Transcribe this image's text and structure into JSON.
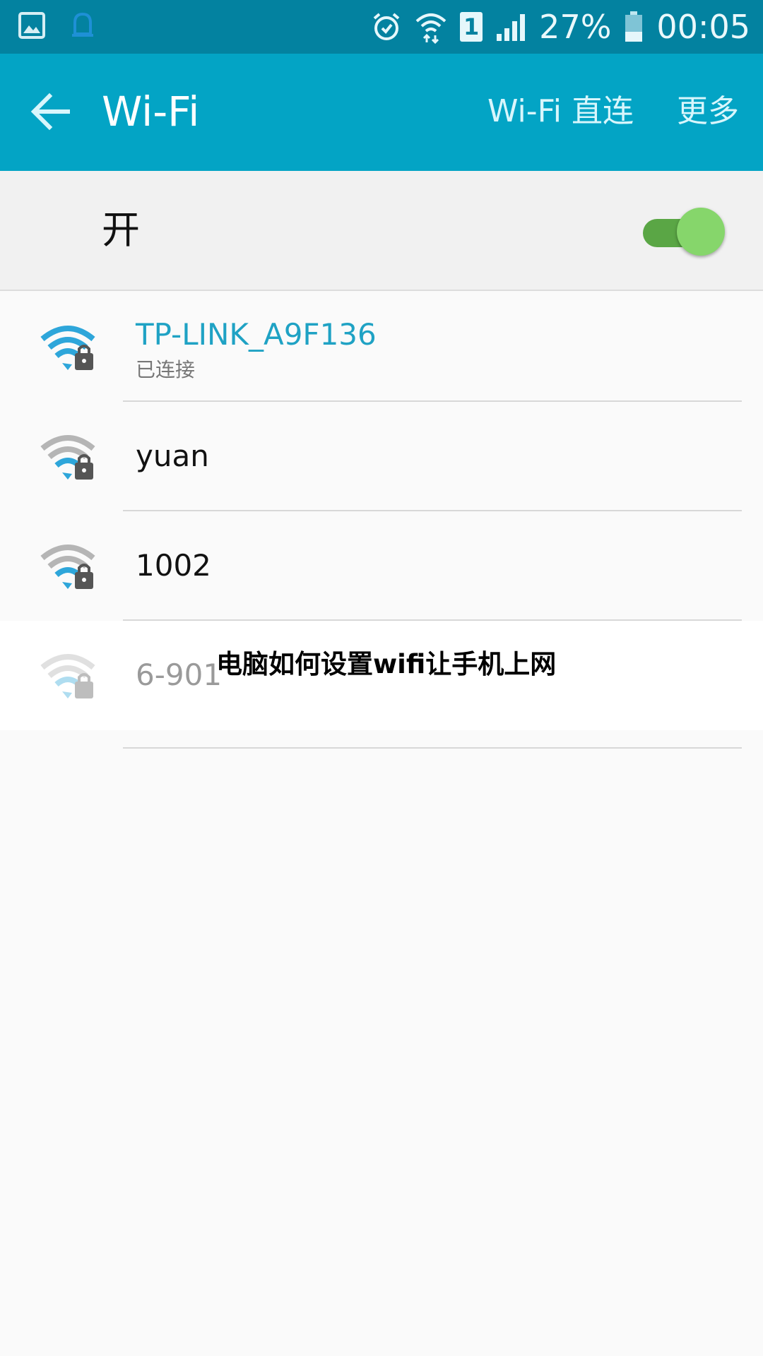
{
  "status_bar": {
    "battery": "27%",
    "time": "00:05",
    "sim_slot": "1",
    "icons": [
      "gallery-icon",
      "notification-icon",
      "alarm-icon",
      "wifi-data-icon",
      "sim-icon",
      "signal-icon",
      "battery-icon"
    ]
  },
  "app_bar": {
    "title": "Wi-Fi",
    "wifi_direct": "Wi-Fi 直连",
    "more": "更多"
  },
  "toggle": {
    "label": "开",
    "state": "on",
    "track_color": "#5aa645",
    "thumb_color": "#86d66b"
  },
  "networks": [
    {
      "name": "TP-LINK_A9F136",
      "status": "已连接",
      "secured": true,
      "signal_level": 4
    },
    {
      "name": "yuan",
      "secured": true,
      "signal_level": 2
    },
    {
      "name": "1002",
      "secured": true,
      "signal_level": 2
    },
    {
      "name": "6-901",
      "secured": true,
      "signal_level": 2
    }
  ],
  "overlay_caption": "电脑如何设置wifi让手机上网",
  "colors": {
    "status_bar": "#0382a0",
    "app_bar": "#03a4c5",
    "accent": "#1fa2c4",
    "background": "#fafafa"
  }
}
